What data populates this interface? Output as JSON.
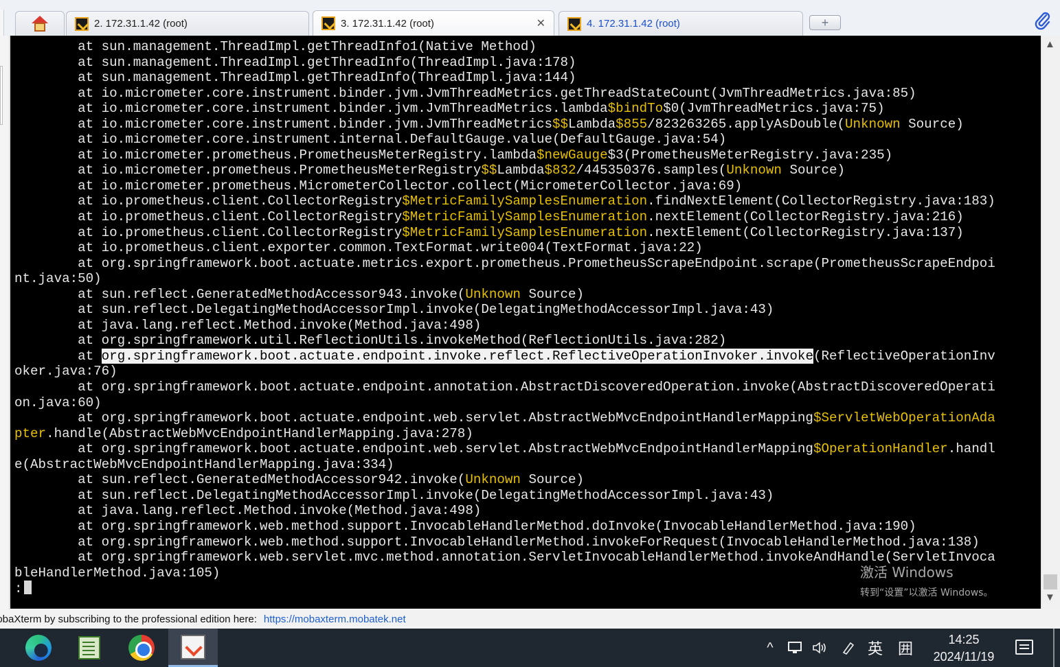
{
  "tabs": [
    {
      "label": "2. 172.31.1.42 (root)",
      "active": false
    },
    {
      "label": "3. 172.31.1.42 (root)",
      "active": true,
      "close": "✕"
    },
    {
      "label": "4. 172.31.1.42 (root)",
      "active": false
    }
  ],
  "icons": {
    "home": "home-icon",
    "session": "ssh-session-icon",
    "new_tab": "add-tab-icon",
    "attach": "paperclip-icon",
    "scroll_up": "▲",
    "scroll_down": "▼"
  },
  "terminal": {
    "lines": [
      [
        {
          "t": "        at sun.management.ThreadImpl.getThreadInfo1(Native Method)"
        }
      ],
      [
        {
          "t": "        at sun.management.ThreadImpl.getThreadInfo(ThreadImpl.java:178)"
        }
      ],
      [
        {
          "t": "        at sun.management.ThreadImpl.getThreadInfo(ThreadImpl.java:144)"
        }
      ],
      [
        {
          "t": "        at io.micrometer.core.instrument.binder.jvm.JvmThreadMetrics.getThreadStateCount(JvmThreadMetrics.java:85)"
        }
      ],
      [
        {
          "t": "        at io.micrometer.core.instrument.binder.jvm.JvmThreadMetrics.lambda"
        },
        {
          "t": "$bindTo",
          "c": "y"
        },
        {
          "t": "$0(JvmThreadMetrics.java:75)"
        }
      ],
      [
        {
          "t": "        at io.micrometer.core.instrument.binder.jvm.JvmThreadMetrics"
        },
        {
          "t": "$$",
          "c": "y"
        },
        {
          "t": "Lambda"
        },
        {
          "t": "$855",
          "c": "y"
        },
        {
          "t": "/823263265.applyAsDouble("
        },
        {
          "t": "Unknown",
          "c": "y"
        },
        {
          "t": " Source)"
        }
      ],
      [
        {
          "t": "        at io.micrometer.core.instrument.internal.DefaultGauge.value(DefaultGauge.java:54)"
        }
      ],
      [
        {
          "t": "        at io.micrometer.prometheus.PrometheusMeterRegistry.lambda"
        },
        {
          "t": "$newGauge",
          "c": "y"
        },
        {
          "t": "$3(PrometheusMeterRegistry.java:235)"
        }
      ],
      [
        {
          "t": "        at io.micrometer.prometheus.PrometheusMeterRegistry"
        },
        {
          "t": "$$",
          "c": "y"
        },
        {
          "t": "Lambda"
        },
        {
          "t": "$832",
          "c": "y"
        },
        {
          "t": "/445350376.samples("
        },
        {
          "t": "Unknown",
          "c": "y"
        },
        {
          "t": " Source)"
        }
      ],
      [
        {
          "t": "        at io.micrometer.prometheus.MicrometerCollector.collect(MicrometerCollector.java:69)"
        }
      ],
      [
        {
          "t": "        at io.prometheus.client.CollectorRegistry"
        },
        {
          "t": "$MetricFamilySamplesEnumeration",
          "c": "y"
        },
        {
          "t": ".findNextElement(CollectorRegistry.java:183)"
        }
      ],
      [
        {
          "t": "        at io.prometheus.client.CollectorRegistry"
        },
        {
          "t": "$MetricFamilySamplesEnumeration",
          "c": "y"
        },
        {
          "t": ".nextElement(CollectorRegistry.java:216)"
        }
      ],
      [
        {
          "t": "        at io.prometheus.client.CollectorRegistry"
        },
        {
          "t": "$MetricFamilySamplesEnumeration",
          "c": "y"
        },
        {
          "t": ".nextElement(CollectorRegistry.java:137)"
        }
      ],
      [
        {
          "t": "        at io.prometheus.client.exporter.common.TextFormat.write004(TextFormat.java:22)"
        }
      ],
      [
        {
          "t": "        at org.springframework.boot.actuate.metrics.export.prometheus.PrometheusScrapeEndpoint.scrape(PrometheusScrapeEndpoi"
        }
      ],
      [
        {
          "t": "nt.java:50)"
        }
      ],
      [
        {
          "t": "        at sun.reflect.GeneratedMethodAccessor943.invoke("
        },
        {
          "t": "Unknown",
          "c": "y"
        },
        {
          "t": " Source)"
        }
      ],
      [
        {
          "t": "        at sun.reflect.DelegatingMethodAccessorImpl.invoke(DelegatingMethodAccessorImpl.java:43)"
        }
      ],
      [
        {
          "t": "        at java.lang.reflect.Method.invoke(Method.java:498)"
        }
      ],
      [
        {
          "t": "        at org.springframework.util.ReflectionUtils.invokeMethod(ReflectionUtils.java:282)"
        }
      ],
      [
        {
          "t": "        at "
        },
        {
          "t": "org.springframework.boot.actuate.endpoint.invoke.reflect.ReflectiveOperationInvoker.invoke",
          "c": "hl"
        },
        {
          "t": "(ReflectiveOperationInv"
        }
      ],
      [
        {
          "t": "oker.java:76)"
        }
      ],
      [
        {
          "t": "        at org.springframework.boot.actuate.endpoint.annotation.AbstractDiscoveredOperation.invoke(AbstractDiscoveredOperati"
        }
      ],
      [
        {
          "t": "on.java:60)"
        }
      ],
      [
        {
          "t": "        at org.springframework.boot.actuate.endpoint.web.servlet.AbstractWebMvcEndpointHandlerMapping"
        },
        {
          "t": "$ServletWebOperationAda",
          "c": "y"
        }
      ],
      [
        {
          "t": "pter",
          "c": "y"
        },
        {
          "t": ".handle(AbstractWebMvcEndpointHandlerMapping.java:278)"
        }
      ],
      [
        {
          "t": "        at org.springframework.boot.actuate.endpoint.web.servlet.AbstractWebMvcEndpointHandlerMapping"
        },
        {
          "t": "$OperationHandler",
          "c": "y"
        },
        {
          "t": ".handl"
        }
      ],
      [
        {
          "t": "e(AbstractWebMvcEndpointHandlerMapping.java:334)"
        }
      ],
      [
        {
          "t": "        at sun.reflect.GeneratedMethodAccessor942.invoke("
        },
        {
          "t": "Unknown",
          "c": "y"
        },
        {
          "t": " Source)"
        }
      ],
      [
        {
          "t": "        at sun.reflect.DelegatingMethodAccessorImpl.invoke(DelegatingMethodAccessorImpl.java:43)"
        }
      ],
      [
        {
          "t": "        at java.lang.reflect.Method.invoke(Method.java:498)"
        }
      ],
      [
        {
          "t": "        at org.springframework.web.method.support.InvocableHandlerMethod.doInvoke(InvocableHandlerMethod.java:190)"
        }
      ],
      [
        {
          "t": "        at org.springframework.web.method.support.InvocableHandlerMethod.invokeForRequest(InvocableHandlerMethod.java:138)"
        }
      ],
      [
        {
          "t": "        at org.springframework.web.servlet.mvc.method.annotation.ServletInvocableHandlerMethod.invokeAndHandle(ServletInvoca"
        }
      ],
      [
        {
          "t": "bleHandlerMethod.java:105)"
        }
      ]
    ],
    "prompt": ":"
  },
  "activation": {
    "title": "激活 Windows",
    "subtitle": "转到“设置”以激活 Windows。"
  },
  "statusbar": {
    "text": "lobaXterm by subscribing to the professional edition here:",
    "link": "https://mobaxterm.mobatek.net"
  },
  "taskbar": {
    "apps": [
      "edge-icon",
      "notepad-icon",
      "chrome-icon",
      "mobaxterm-icon"
    ],
    "tray": {
      "chevron": "^",
      "ime": "英",
      "grid_glyph": "囲"
    },
    "time": "14:25",
    "date": "2024/11/19"
  },
  "colors": {
    "terminal_bg": "#000000",
    "terminal_fg": "#e8e8e8",
    "terminal_yellow": "#e6c000",
    "link": "#1c5ed6",
    "taskbar_bg": "#1f2730"
  }
}
